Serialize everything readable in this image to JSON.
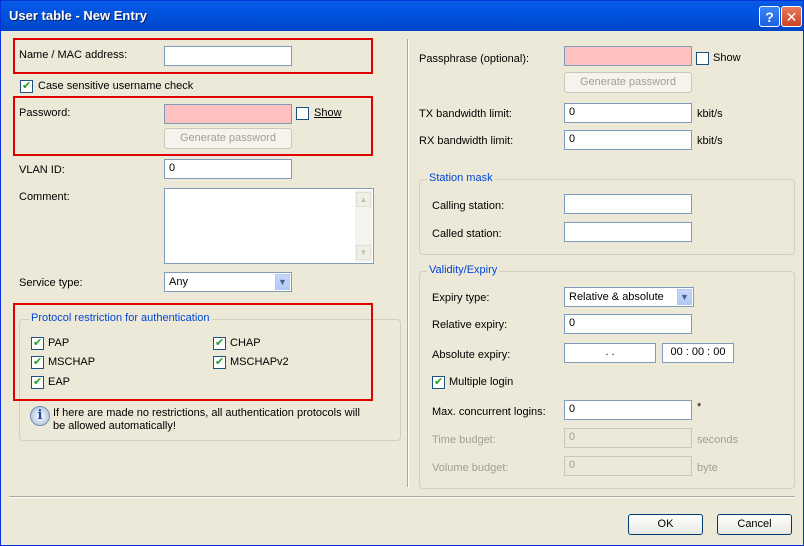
{
  "window": {
    "title": "User table - New Entry",
    "help_glyph": "?",
    "close_glyph": "✕"
  },
  "left": {
    "name_label": "Name / MAC address:",
    "name_value": "",
    "case_label": "Case sensitive username check",
    "case_checked": true,
    "password_label": "Password:",
    "password_value": "",
    "show_label": "Show",
    "show_checked": false,
    "generate_label": "Generate password",
    "vlan_label": "VLAN ID:",
    "vlan_value": "0",
    "comment_label": "Comment:",
    "comment_value": "",
    "service_label": "Service type:",
    "service_value": "Any",
    "protocol_group_label": "Protocol restriction for authentication",
    "protocols": [
      {
        "label": "PAP",
        "checked": true
      },
      {
        "label": "CHAP",
        "checked": true
      },
      {
        "label": "MSCHAP",
        "checked": true
      },
      {
        "label": "MSCHAPv2",
        "checked": true
      },
      {
        "label": "EAP",
        "checked": true
      }
    ],
    "info_text_1": "If here are made no restrictions, all authentication protocols will",
    "info_text_2": "be allowed automatically!"
  },
  "right": {
    "passphrase_label": "Passphrase (optional):",
    "passphrase_value": "",
    "show_label": "Show",
    "generate_label": "Generate password",
    "tx_label": "TX bandwidth limit:",
    "tx_value": "0",
    "tx_unit": "kbit/s",
    "rx_label": "RX bandwidth limit:",
    "rx_value": "0",
    "rx_unit": "kbit/s",
    "station_group_label": "Station mask",
    "calling_label": "Calling station:",
    "calling_value": "",
    "called_label": "Called station:",
    "called_value": "",
    "validity_group_label": "Validity/Expiry",
    "expiry_type_label": "Expiry type:",
    "expiry_type_value": "Relative & absolute",
    "relative_label": "Relative expiry:",
    "relative_value": "0",
    "absolute_label": "Absolute expiry:",
    "absolute_date": ". .",
    "absolute_time": "00 : 00 : 00",
    "multiple_login_label": "Multiple login",
    "max_logins_label": "Max. concurrent logins:",
    "max_logins_value": "0",
    "max_logins_unit": "*",
    "time_budget_label": "Time budget:",
    "time_budget_value": "0",
    "time_budget_unit": "seconds",
    "volume_budget_label": "Volume budget:",
    "volume_budget_value": "0",
    "volume_budget_unit": "byte"
  },
  "footer": {
    "ok_label": "OK",
    "cancel_label": "Cancel"
  },
  "colors": {
    "title_bar": "#0053e0",
    "pink_field": "#ffc0c0",
    "group_label": "#0046d5",
    "highlight": "#e00000"
  },
  "icons": {
    "info": "info-icon",
    "dropdown": "chevron-down-icon"
  }
}
